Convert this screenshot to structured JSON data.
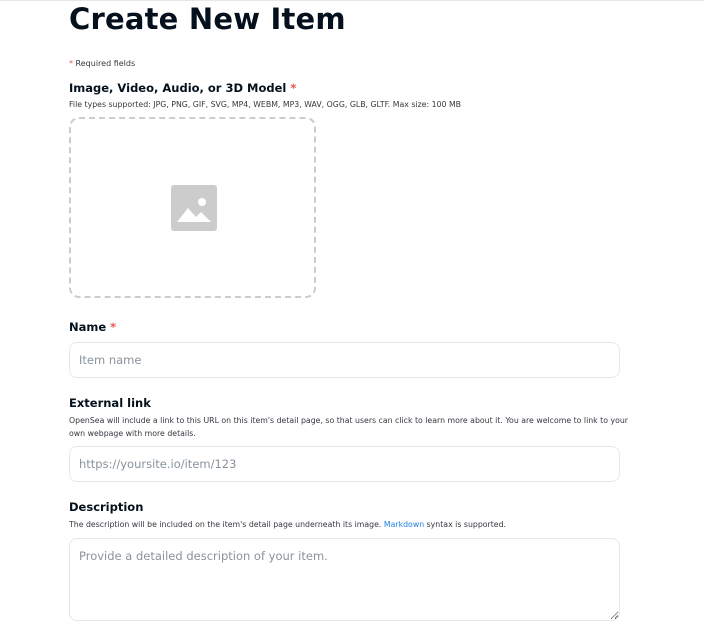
{
  "page": {
    "title": "Create New Item",
    "required_note": "Required fields",
    "asterisk": "*"
  },
  "media": {
    "label": "Image, Video, Audio, or 3D Model",
    "help": "File types supported: JPG, PNG, GIF, SVG, MP4, WEBM, MP3, WAV, OGG, GLB, GLTF. Max size: 100 MB",
    "icon": "image-icon"
  },
  "name": {
    "label": "Name",
    "placeholder": "Item name",
    "value": ""
  },
  "external_link": {
    "label": "External link",
    "help": "OpenSea will include a link to this URL on this item's detail page, so that users can click to learn more about it. You are welcome to link to your own webpage with more details.",
    "placeholder": "https://yoursite.io/item/123",
    "value": ""
  },
  "description": {
    "label": "Description",
    "help_prefix": "The description will be included on the item's detail page underneath its image.",
    "help_link": "Markdown",
    "help_suffix": "syntax is supported.",
    "placeholder": "Provide a detailed description of your item.",
    "value": ""
  },
  "colors": {
    "required": "#eb5757",
    "link": "#2081e2",
    "border": "#e5e8eb",
    "dropzone_border": "#cccccc",
    "icon": "#cccccc"
  }
}
